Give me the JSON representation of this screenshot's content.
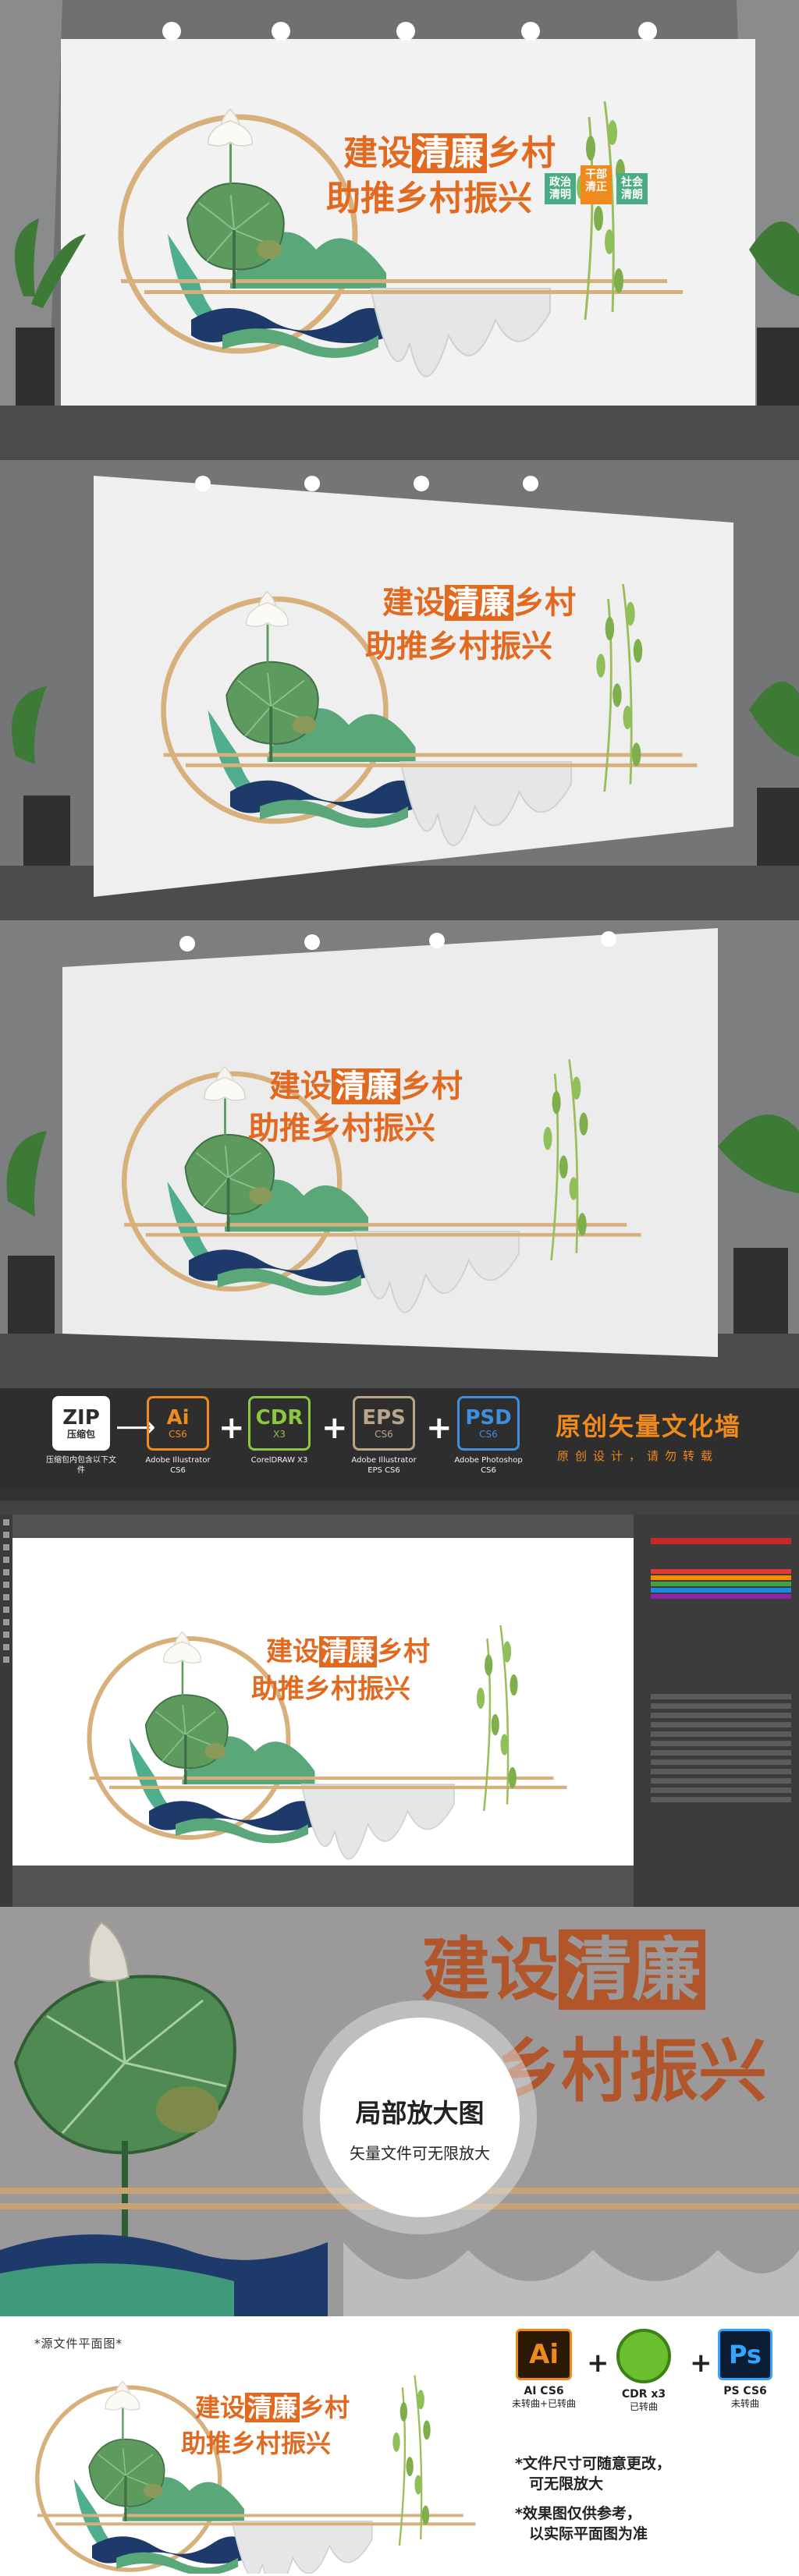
{
  "sign": {
    "line1_a": "建设",
    "line1_b": "清廉",
    "line1_c": "乡村",
    "line2": "助推乡村振兴",
    "tags": [
      {
        "top": "政治",
        "bottom": "清明",
        "color": "#4bab85"
      },
      {
        "top": "干部",
        "bottom": "清正",
        "color": "#f08a1c"
      },
      {
        "top": "社会",
        "bottom": "清朗",
        "color": "#4bab85"
      }
    ],
    "colors": {
      "orange": "#e26a20",
      "green": "#5aa87a",
      "navy": "#1e3a6b",
      "gold": "#d7b07c"
    }
  },
  "software": {
    "zip": {
      "name": "ZIP",
      "label": "压缩包",
      "caption": "压缩包内包含以下文件"
    },
    "items": [
      {
        "name": "Ai",
        "ver": "CS6",
        "caption": "Adobe Illustrator CS6",
        "color": "#f08a1c"
      },
      {
        "name": "CDR",
        "ver": "X3",
        "caption": "CorelDRAW X3",
        "color": "#8dc63f"
      },
      {
        "name": "EPS",
        "ver": "CS6",
        "caption": "Adobe Illustrator EPS CS6",
        "color": "#b9a58a"
      },
      {
        "name": "PSD",
        "ver": "CS6",
        "caption": "Adobe Photoshop CS6",
        "color": "#3f8ee0"
      }
    ],
    "slogan": "原创矢量文化墙",
    "slogan_sub": "原创设计，请勿转载"
  },
  "zoom": {
    "title": "局部放大图",
    "subtitle": "矢量文件可无限放大"
  },
  "flat": {
    "label": "*源文件平面图*",
    "formats": [
      {
        "name": "Ai",
        "caption": "AI CS6",
        "caption2": "未转曲+已转曲"
      },
      {
        "name": "CDR",
        "caption": "CDR x3",
        "caption2": "已转曲"
      },
      {
        "name": "Ps",
        "caption": "PS CS6",
        "caption2": "未转曲"
      }
    ],
    "notes": [
      "*文件尺寸可随意更改，",
      "可无限放大",
      "*效果图仅供参考，",
      "以实际平面图为准"
    ]
  }
}
